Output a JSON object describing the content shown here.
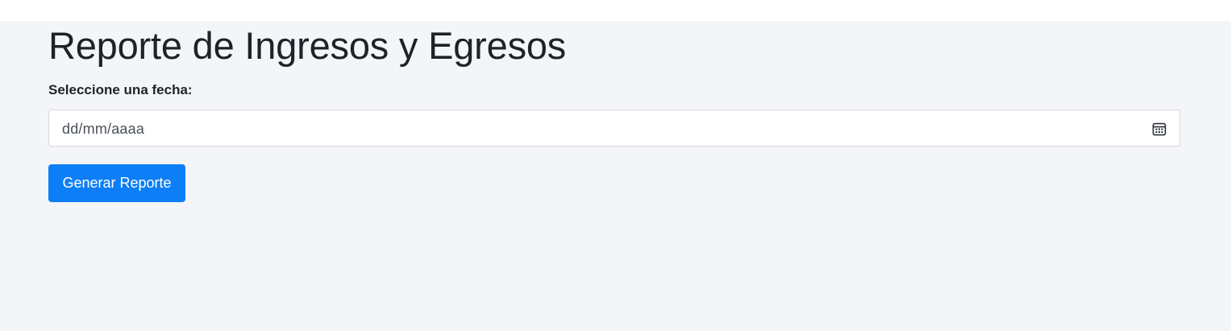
{
  "page": {
    "title": "Reporte de Ingresos y Egresos"
  },
  "form": {
    "date_label": "Seleccione una fecha:",
    "date_placeholder": "dd/mm/aaaa",
    "date_icon": "calendar-icon",
    "submit_label": "Generar Reporte"
  },
  "colors": {
    "background": "#f4f5f9",
    "primary_button": "#0d7ef6",
    "text": "#1f2329"
  }
}
